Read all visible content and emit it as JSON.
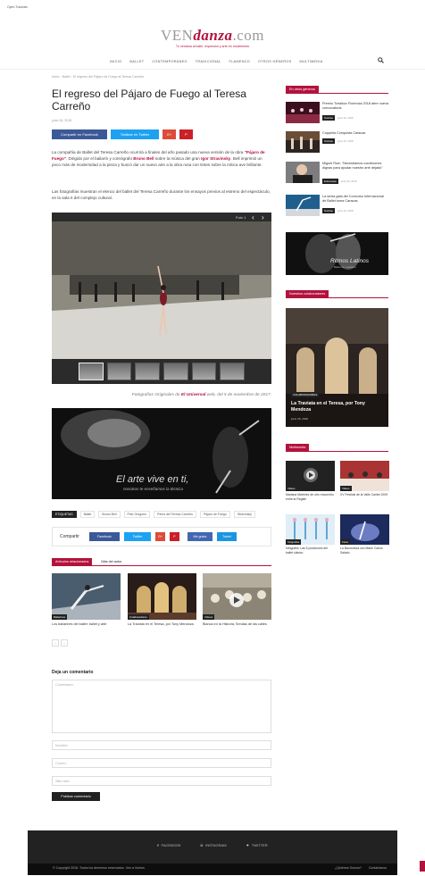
{
  "topbar": {
    "text": "Open Tutorials"
  },
  "logo": {
    "ven": "VEN",
    "danza": "danza",
    "com": ".com",
    "tagline": "Tu ventana al baile, expresión y arte en movimiento"
  },
  "nav": {
    "items": [
      "INICIO",
      "BALLET",
      "CONTEMPORÁNEO",
      "TRADICIONAL",
      "FLAMENCO",
      "OTROS GÉNEROS",
      "MULTIMEDIA"
    ]
  },
  "breadcrumb": "Inicio › Ballet › El regreso del Pájaro de Fuego al Teresa Carreño",
  "article": {
    "title": "El regreso del Pájaro de Fuego al Teresa Carreño",
    "date": "junio 26, 2018",
    "share_buttons": [
      "Compartir en Facebook",
      "Twittear en Twitter",
      "G+",
      "P"
    ],
    "para1_a": "La compañía de Ballet del Teresa Carreño ocurrirá a finales del año pasado una nueva versión de la obra ",
    "para1_r1": "\"Pájaro de Fuego\"",
    "para1_b": ". Dirigido por el bailarín y coreógrafo ",
    "para1_r2": "Bruno Bell",
    "para1_c": " sobre la música del gran ",
    "para1_r3": "Igor Stravinsky",
    "para1_d": ". Bell imprimió un poco más de modernidad a la pieza y buscó dar un nuevo aire a la obra rusa con tintes sobre la mítica ave brillante.",
    "para2": "Las fotografías muestran el elenco del ballet del Teresa Carreño durante los ensayos previos al estreno del espectáculo, en la sala II del complejo cultural.",
    "gallery_counter": "Foto 1",
    "caption_a": "Fotografías Originales de ",
    "caption_b": "El Universal",
    "caption_c": " web, del 5 de noviembre de 2017.",
    "banner_title": "El arte vive en ti,",
    "banner_sub": "nosotros te enseñamos la técnica"
  },
  "tags": {
    "label": "ETIQUETAS",
    "items": [
      "Ballet",
      "Bruno Bell",
      "Pelo Gregorio",
      "Pérez del Teresa Carreño",
      "Pájaro de Fuego",
      "Stravinsky"
    ]
  },
  "sharebox": {
    "label": "Compartir",
    "buttons": [
      "Facebook",
      "Twitter",
      "G+",
      "P"
    ],
    "like": "Me gusta",
    "tweet": "Tweet"
  },
  "related": {
    "tabs": [
      "Artículos relacionados",
      "Más del autor"
    ],
    "items": [
      {
        "badge": "Bailarines",
        "title": "Los bailarines del ballet: ballet y arte"
      },
      {
        "badge": "Colaboradores",
        "title": "La Traviata en el Teresa, por Tony Mendoza"
      },
      {
        "badge": "Videos",
        "title": "Blanca en la Historia, Sendas de las calles"
      }
    ],
    "pager": [
      "‹",
      "›"
    ]
  },
  "comments": {
    "title": "Deja un comentario",
    "placeholder": "Comentario:",
    "name": "Nombre:",
    "email": "Correo:",
    "website": "Sitio web:",
    "submit": "Publicar comentario"
  },
  "footer": {
    "social": [
      "FACEBOOK",
      "INSTAGRAM",
      "TWITTER"
    ],
    "copyright": "© Copyright 2018. Todos los derechos reservados. Ven a Vuelos.",
    "links": [
      "¿Quiénes Somos?",
      "Contáctanos"
    ]
  },
  "sidebar": {
    "section1": "En otros géneros",
    "popular": [
      {
        "title": "Premio Tchaikov Florencia 2018 abre nueva convocatoria",
        "badge": "Noticias",
        "date": "junio 26, 2018"
      },
      {
        "title": "Coppelia Conquista Caracas",
        "badge": "Noticias",
        "date": "junio 26, 2018"
      },
      {
        "title": "Miguel Ruiz: \"Necesitamos condiciones dignas para ayudar nuestro arte dejado\"",
        "badge": "Entrevistas",
        "date": "junio 26, 2018"
      },
      {
        "title": "La sexta gala del Concurso Internacional de Ballet toma Caracas",
        "badge": "Noticias",
        "date": "junio 26, 2018"
      }
    ],
    "ritmos": "Ritmos Latinos",
    "ritmos_sub": "Baila con nosotros",
    "section2": "Nuestros colaboradores",
    "collab_badge": "COLABORADORES",
    "collab_title": "La Traviata en el Teresa, por Tony Mendoza",
    "collab_date": "junio 26, 2018",
    "section3": "Multimedia",
    "multimedia": [
      {
        "badge": "Videos",
        "title": "Mariana Martínez de otro encuentro entre la Regale"
      },
      {
        "badge": "Videos",
        "title": "XV Festival de la Valle Caribe 2009"
      },
      {
        "badge": "Infografías",
        "title": "Infografía: Las 5 posiciones del ballet clásico"
      },
      {
        "badge": "Fotos",
        "title": "La Bauronesa con Marie Carlos Salado"
      }
    ]
  }
}
